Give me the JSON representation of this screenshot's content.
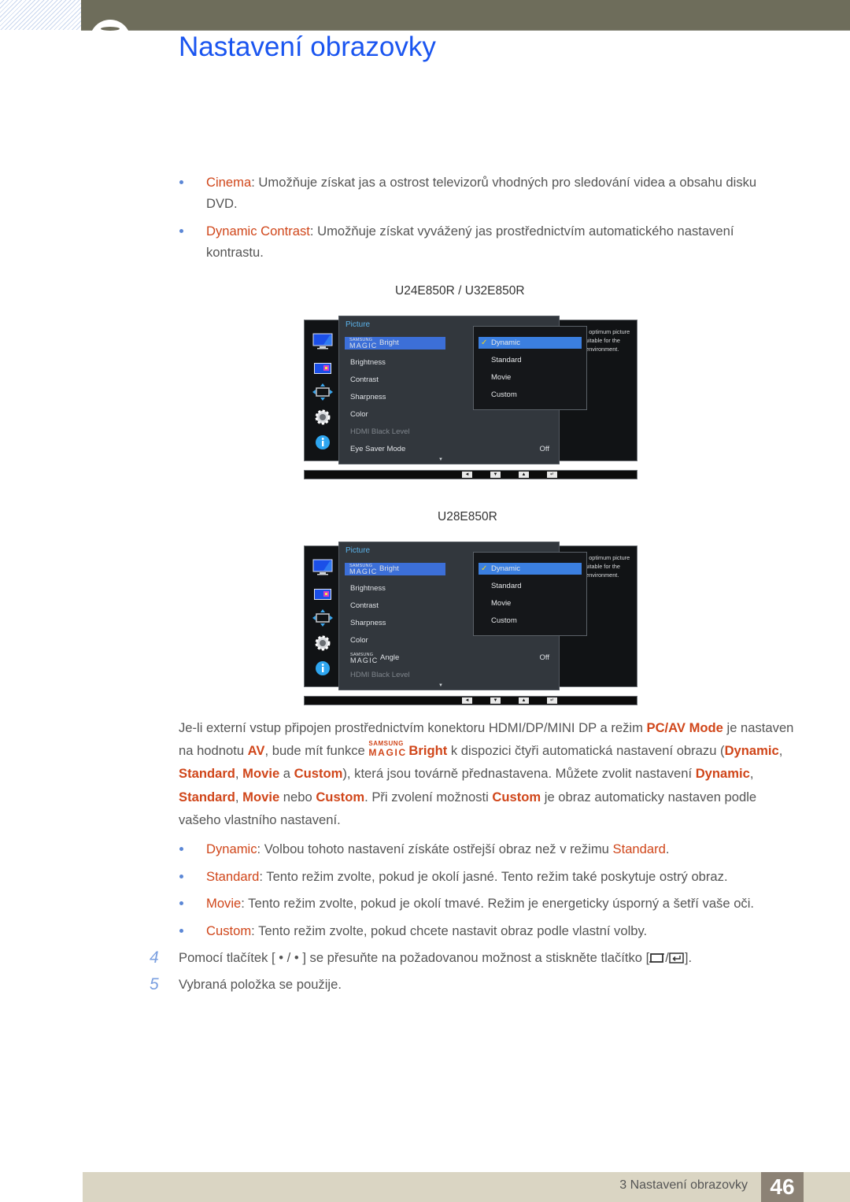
{
  "header": {
    "title": "Nastavení obrazovky"
  },
  "top_bullets": [
    {
      "term": "Cinema",
      "text": ": Umožňuje získat jas a ostrost televizorů vhodných pro sledování videa a obsahu disku",
      "cont": "DVD."
    },
    {
      "term": "Dynamic Contrast",
      "text": ": Umožňuje získat vyvážený jas prostřednictvím automatického nastavení",
      "cont": "kontrastu."
    }
  ],
  "osd_screens": [
    {
      "model_label": "U24E850R / U32E850R",
      "menu_title": "Picture",
      "magic_small": "SAMSUNG",
      "magic_big": "MAGIC",
      "selected_item": "Bright",
      "items": [
        "Brightness",
        "Contrast",
        "Sharpness",
        "Color"
      ],
      "dim_item": "HDMI Black Level",
      "last_item": {
        "label": "Eye Saver Mode",
        "value": "Off"
      },
      "submenu": [
        "Dynamic",
        "Standard",
        "Movie",
        "Custom"
      ],
      "help_text": "Set to an optimum picture quality suitable for the working environment."
    },
    {
      "model_label": "U28E850R",
      "menu_title": "Picture",
      "magic_small": "SAMSUNG",
      "magic_big": "MAGIC",
      "selected_item": "Bright",
      "items": [
        "Brightness",
        "Contrast",
        "Sharpness",
        "Color"
      ],
      "angle_item": {
        "label": "Angle",
        "value": "Off"
      },
      "dim_item": "HDMI Black Level",
      "submenu": [
        "Dynamic",
        "Standard",
        "Movie",
        "Custom"
      ],
      "help_text": "Set to an optimum picture quality suitable for the working environment."
    }
  ],
  "osd_nav": {
    "left": "◄",
    "down": "▼",
    "up": "▲",
    "enter": "↵"
  },
  "paragraph": {
    "p1": "Je-li externí vstup připojen prostřednictvím konektoru HDMI/DP/MINI DP a režim ",
    "pc_av_mode": "PC/AV Mode",
    "p2": " je nastaven na hodnotu ",
    "av": "AV",
    "p3": ", bude mít funkce ",
    "magic_small": "SAMSUNG",
    "magic_big": "MAGIC",
    "bright": "Bright",
    "p4": " k dispozici čtyři automatická nastavení obrazu (",
    "dynamic": "Dynamic",
    "comma": ", ",
    "standard": "Standard",
    "movie": "Movie",
    "and": " a ",
    "custom": "Custom",
    "p5": "), která jsou továrně přednastavena. Můžete zvolit nastavení ",
    "or": " nebo ",
    "p6": ". Při zvolení možnosti ",
    "p7": " je obraz automaticky nastaven podle vašeho vlastního nastavení."
  },
  "mode_bullets": [
    {
      "term": "Dynamic",
      "text": ": Volbou tohoto nastavení získáte ostřejší obraz než v režimu ",
      "term2": "Standard",
      "tail": "."
    },
    {
      "term": "Standard",
      "text": ": Tento režim zvolte, pokud je okolí jasné. Tento režim také poskytuje ostrý obraz."
    },
    {
      "term": "Movie",
      "text": ": Tento režim zvolte, pokud je okolí tmavé. Režim je energeticky úsporný a šetří vaše oči."
    },
    {
      "term": "Custom",
      "text": ": Tento režim zvolte, pokud chcete nastavit obraz podle vlastní volby."
    }
  ],
  "steps": [
    {
      "num": "4",
      "pre": "Pomocí tlačítek [ • / • ] se přesuňte na požadovanou možnost a stiskněte tlačítko [",
      "post": "]."
    },
    {
      "num": "5",
      "pre": "Vybraná položka se použije."
    }
  ],
  "footer": {
    "chapter": "3 Nastavení obrazovky",
    "page": "46"
  },
  "colors": {
    "title_blue": "#1a55f0",
    "term_orange": "#d0461a",
    "header_bar": "#6e6d5b",
    "footer_bar": "#dad5c3",
    "page_box": "#8c8275"
  }
}
